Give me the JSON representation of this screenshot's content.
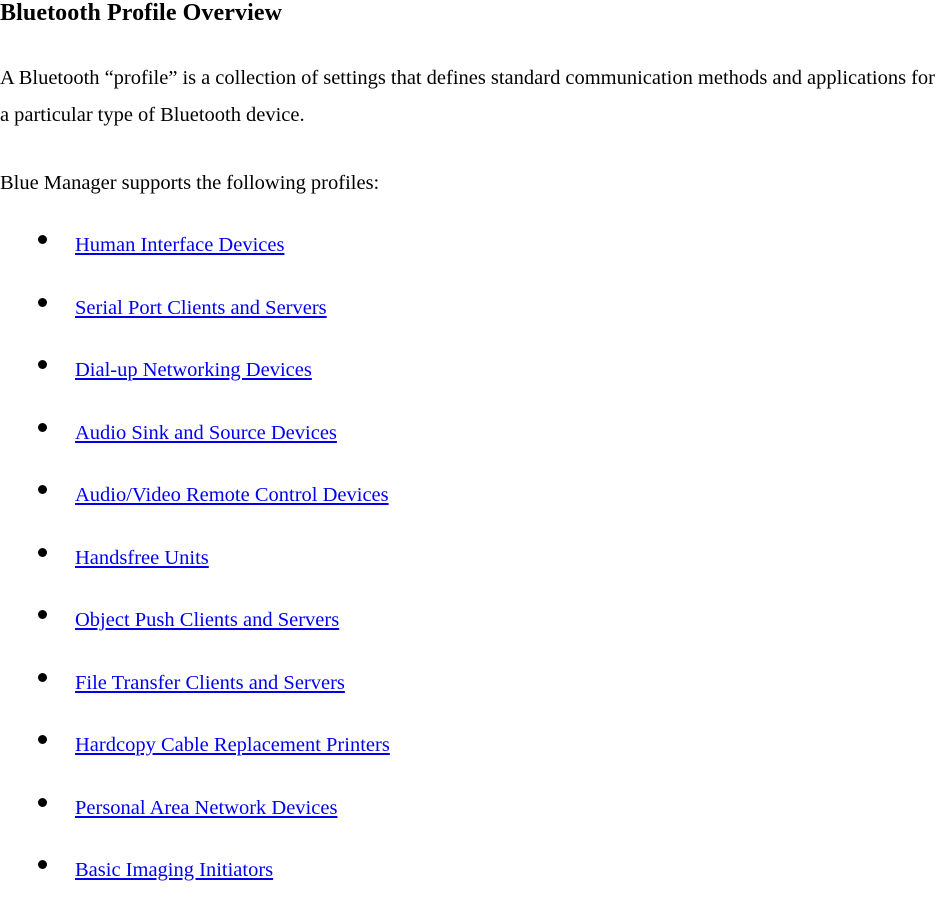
{
  "document": {
    "heading": "Bluetooth Profile Overview",
    "paragraphs": [
      "A Bluetooth “profile” is a collection of settings that defines standard communication methods and applications for a particular type of Bluetooth device.",
      "Blue Manager supports the following profiles:"
    ],
    "profile_list": {
      "bullet_glyph": "•",
      "link_color": "#0000EE",
      "text_color": "#000000",
      "background_color": "#FFFFFF",
      "items": [
        {
          "label": "Human Interface Devices"
        },
        {
          "label": "Serial Port Clients and Servers"
        },
        {
          "label": "Dial-up Networking Devices"
        },
        {
          "label": "Audio Sink and Source Devices"
        },
        {
          "label": "Audio/Video Remote Control Devices"
        },
        {
          "label": "Handsfree Units"
        },
        {
          "label": "Object Push Clients and Servers"
        },
        {
          "label": "File Transfer Clients and Servers"
        },
        {
          "label": "Hardcopy Cable Replacement Printers"
        },
        {
          "label": "Personal Area Network Devices"
        },
        {
          "label": "Basic Imaging Initiators"
        }
      ]
    }
  }
}
